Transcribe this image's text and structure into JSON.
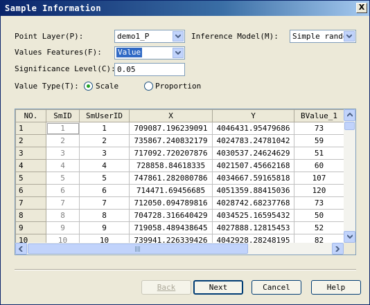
{
  "window": {
    "title": "Sample Information",
    "close_glyph": "X"
  },
  "form": {
    "point_layer_label": "Point Layer(P):",
    "point_layer_value": "demo1_P",
    "inference_model_label": "Inference Model(M):",
    "inference_model_value": "Simple rando",
    "values_features_label": "Values Features(F):",
    "values_features_value": "Value",
    "significance_label": "Significance Level(C):",
    "significance_value": "0.05",
    "value_type_label": "Value Type(T):",
    "option_scale": "Scale",
    "option_proportion": "Proportion",
    "value_type_selected": "Scale"
  },
  "grid": {
    "columns": [
      "NO.",
      "SmID",
      "SmUserID",
      "X",
      "Y",
      "BValue_1"
    ],
    "rows": [
      [
        "1",
        "1",
        "1",
        "709087.196239091",
        "4046431.95479686",
        "73"
      ],
      [
        "2",
        "2",
        "2",
        "735867.240832179",
        "4024783.24781042",
        "59"
      ],
      [
        "3",
        "3",
        "3",
        "717092.720207876",
        "4030537.24624629",
        "51"
      ],
      [
        "4",
        "4",
        "4",
        "728858.84618335",
        "4021507.45662168",
        "60"
      ],
      [
        "5",
        "5",
        "5",
        "747861.282080786",
        "4034667.59165818",
        "107"
      ],
      [
        "6",
        "6",
        "6",
        "714471.69456685",
        "4051359.88415036",
        "120"
      ],
      [
        "7",
        "7",
        "7",
        "712050.094789816",
        "4028742.68237768",
        "73"
      ],
      [
        "8",
        "8",
        "8",
        "704728.316640429",
        "4034525.16595432",
        "50"
      ],
      [
        "9",
        "9",
        "9",
        "719058.489438645",
        "4027888.12815453",
        "52"
      ],
      [
        "10",
        "10",
        "10",
        "739941.226339426",
        "4042928.28248195",
        "82"
      ]
    ]
  },
  "buttons": {
    "back": "Back",
    "next": "Next",
    "cancel": "Cancel",
    "help": "Help"
  },
  "colors": {
    "title_start": "#0a246a",
    "title_end": "#a6caf0",
    "selection": "#316ac5",
    "face": "#ece9d8"
  }
}
